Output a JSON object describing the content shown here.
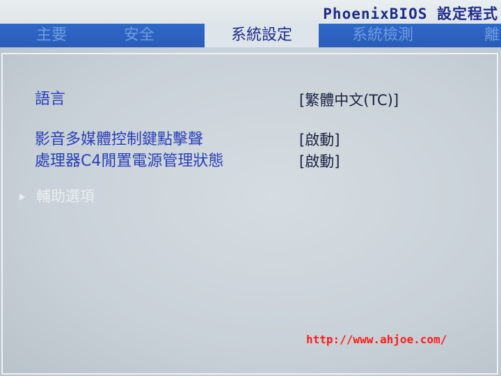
{
  "title": "PhoenixBIOS 設定程式",
  "tabs": [
    {
      "label": "主要"
    },
    {
      "label": "安全"
    },
    {
      "label": "系統設定",
      "active": true
    },
    {
      "label": "系統檢測"
    },
    {
      "label": "離"
    }
  ],
  "settings": [
    {
      "label": "語言",
      "value": "[繁體中文(TC)]"
    },
    {
      "label": "影音多媒體控制鍵點擊聲",
      "value": "[啟動]"
    },
    {
      "label": "處理器C4閒置電源管理狀態",
      "value": "[啟動]"
    }
  ],
  "submenu": {
    "label": "輔助選項"
  },
  "watermark": "http://www.ahjoe.com/"
}
